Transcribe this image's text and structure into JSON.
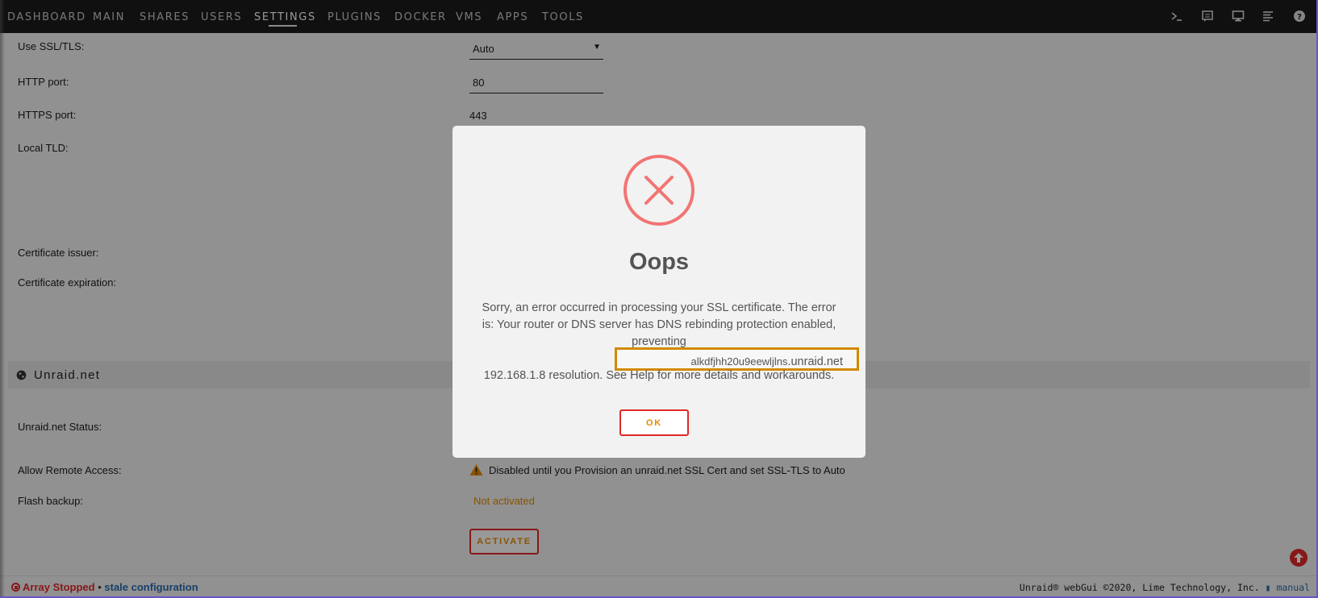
{
  "nav": {
    "items": [
      "DASHBOARD",
      "MAIN",
      "SHARES",
      "USERS",
      "SETTINGS",
      "PLUGINS",
      "DOCKER",
      "VMS",
      "APPS",
      "TOOLS"
    ],
    "active": "SETTINGS",
    "icons": [
      "terminal-icon",
      "log-icon",
      "desktop-icon",
      "list-icon",
      "help-icon"
    ]
  },
  "settings": {
    "use_ssl_label": "Use SSL/TLS:",
    "use_ssl_value": "Auto",
    "http_port_label": "HTTP port:",
    "http_port_value": "80",
    "https_port_label": "HTTPS port:",
    "https_port_value": "443",
    "local_tld_label": "Local TLD:",
    "cert_issuer_label": "Certificate issuer:",
    "cert_expiration_label": "Certificate expiration:"
  },
  "unraid_net": {
    "section_title": "Unraid.net",
    "status_label": "Unraid.net Status:",
    "remote_access_label": "Allow Remote Access:",
    "remote_access_value": "Disabled until you Provision an unraid.net SSL Cert and set SSL-TLS to Auto",
    "flash_backup_label": "Flash backup:",
    "flash_backup_value": "Not activated",
    "activate_label": "ACTIVATE"
  },
  "footer": {
    "array_status": "Array Stopped",
    "separator": "•",
    "config_status": "stale configuration",
    "copyright": "Unraid® webGui ©2020, Lime Technology, Inc.",
    "manual_label": "manual"
  },
  "modal": {
    "title": "Oops",
    "message_line1": "Sorry, an error occurred in processing your SSL certificate. The error",
    "message_line2": "is: Your router or DNS server has DNS rebinding protection enabled,",
    "message_line3": "preventing",
    "host_prefix": "alkdfjhh20u9eewljlns",
    "host_suffix": ".unraid.net",
    "message_line5": "192.168.1.8 resolution. See Help for more details and workarounds.",
    "ok_label": "OK"
  },
  "colors": {
    "nav_bg": "#1c1c1c",
    "accent_red": "#e22828",
    "accent_orange": "#e68a00",
    "error_icon": "#f27474",
    "highlight_border": "#d18a00",
    "link_blue": "#2b6cb0"
  }
}
